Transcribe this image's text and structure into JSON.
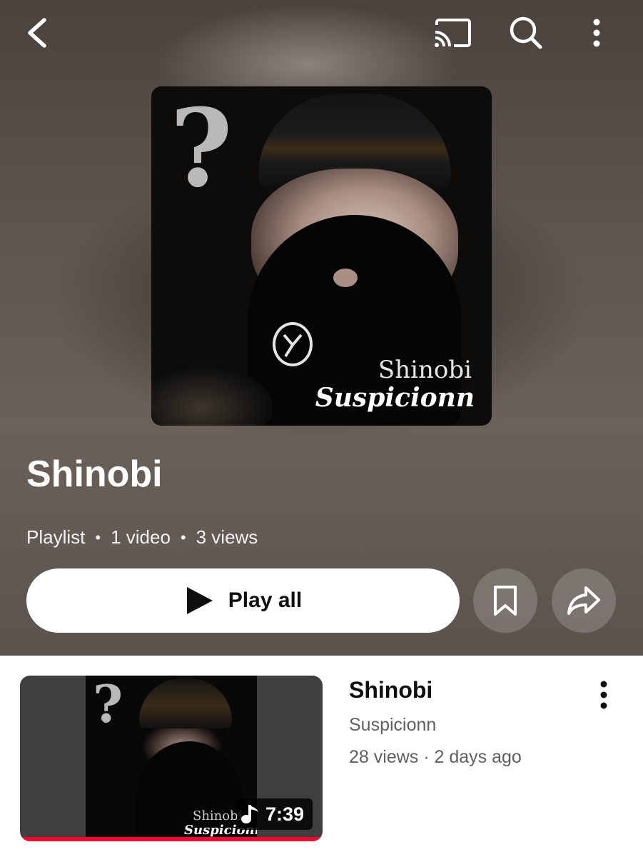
{
  "header": {
    "icons": [
      "chevron-left-icon",
      "cast-icon",
      "search-icon",
      "more-vertical-icon"
    ]
  },
  "cover": {
    "title": "Shinobi",
    "artist": "Suspicionn",
    "logo": "?"
  },
  "playlist": {
    "title": "Shinobi",
    "type": "Playlist",
    "video_count": "1 video",
    "views": "3 views",
    "separator": "•"
  },
  "actions": {
    "play_all_label": "Play all",
    "save_icon": "bookmark-icon",
    "share_icon": "share-icon"
  },
  "videos": [
    {
      "title": "Shinobi",
      "channel": "Suspicionn",
      "stats": "28 views · 2 days ago",
      "duration": "7:39",
      "watched_fraction": 1.0,
      "thumb_text_1": "Shinobi",
      "thumb_text_2": "Suspicionn",
      "thumb_logo": "?"
    }
  ],
  "colors": {
    "progress": "#ff0033",
    "play_button_bg": "#ffffff",
    "text_primary": "#0f0f0f",
    "text_secondary": "#606060"
  }
}
